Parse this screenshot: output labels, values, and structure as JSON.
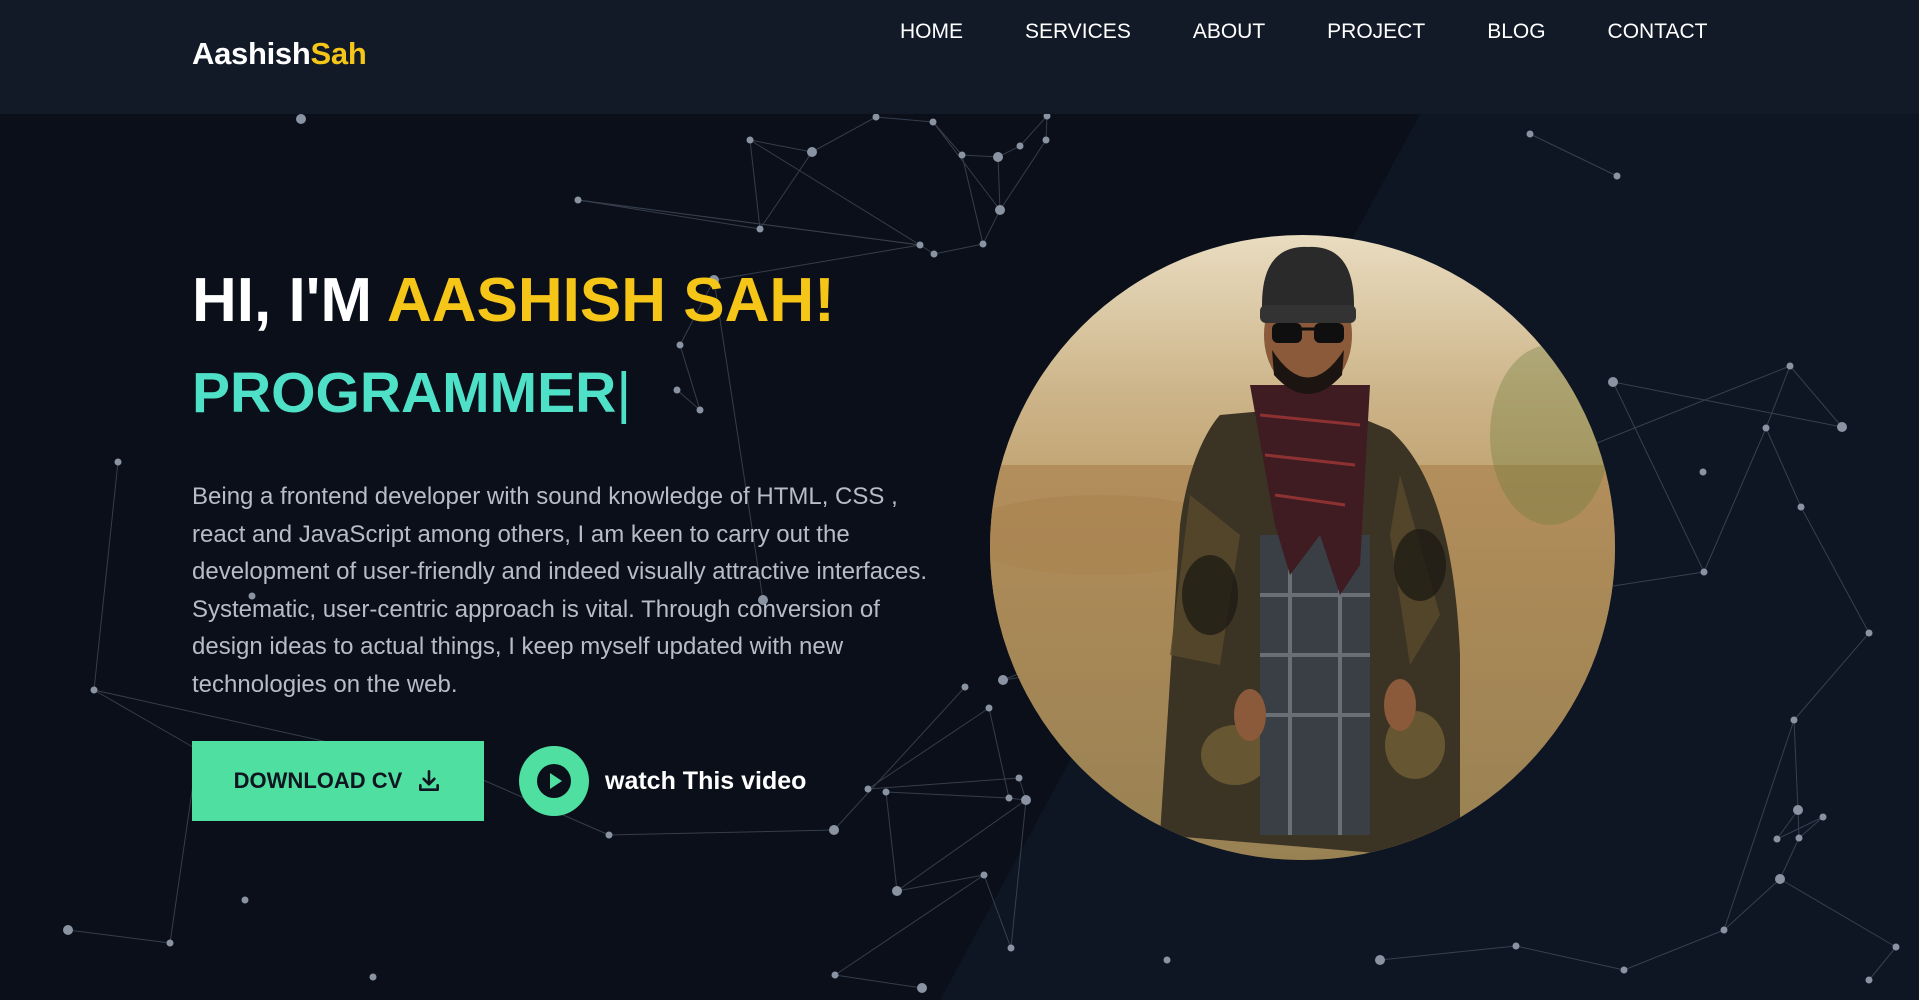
{
  "nav": {
    "logo_first": "Aashish",
    "logo_second": "Sah",
    "links": [
      "HOME",
      "SERVICES",
      "ABOUT",
      "PROJECT",
      "BLOG",
      "CONTACT"
    ]
  },
  "hero": {
    "greeting_prefix": "HI, I'M ",
    "greeting_name": "AASHISH SAH!",
    "role": "PROGRAMMER",
    "cursor": "|",
    "bio": "Being a frontend developer with sound knowledge of HTML, CSS , react and JavaScript among others, I am keen to carry out the development of user-friendly and indeed visually attractive interfaces. Systematic, user-centric approach is vital. Through conversion of design ideas to actual things, I keep myself updated with new technologies on the web.",
    "download_label": "DOWNLOAD CV",
    "download_icon": "download-icon",
    "video_label": "watch This video",
    "play_icon": "play-icon"
  },
  "colors": {
    "background": "#0a0f19",
    "navbar": "#121a27",
    "accent_yellow": "#f5c518",
    "accent_teal": "#4fe0c8",
    "accent_green": "#4fe0a1"
  }
}
